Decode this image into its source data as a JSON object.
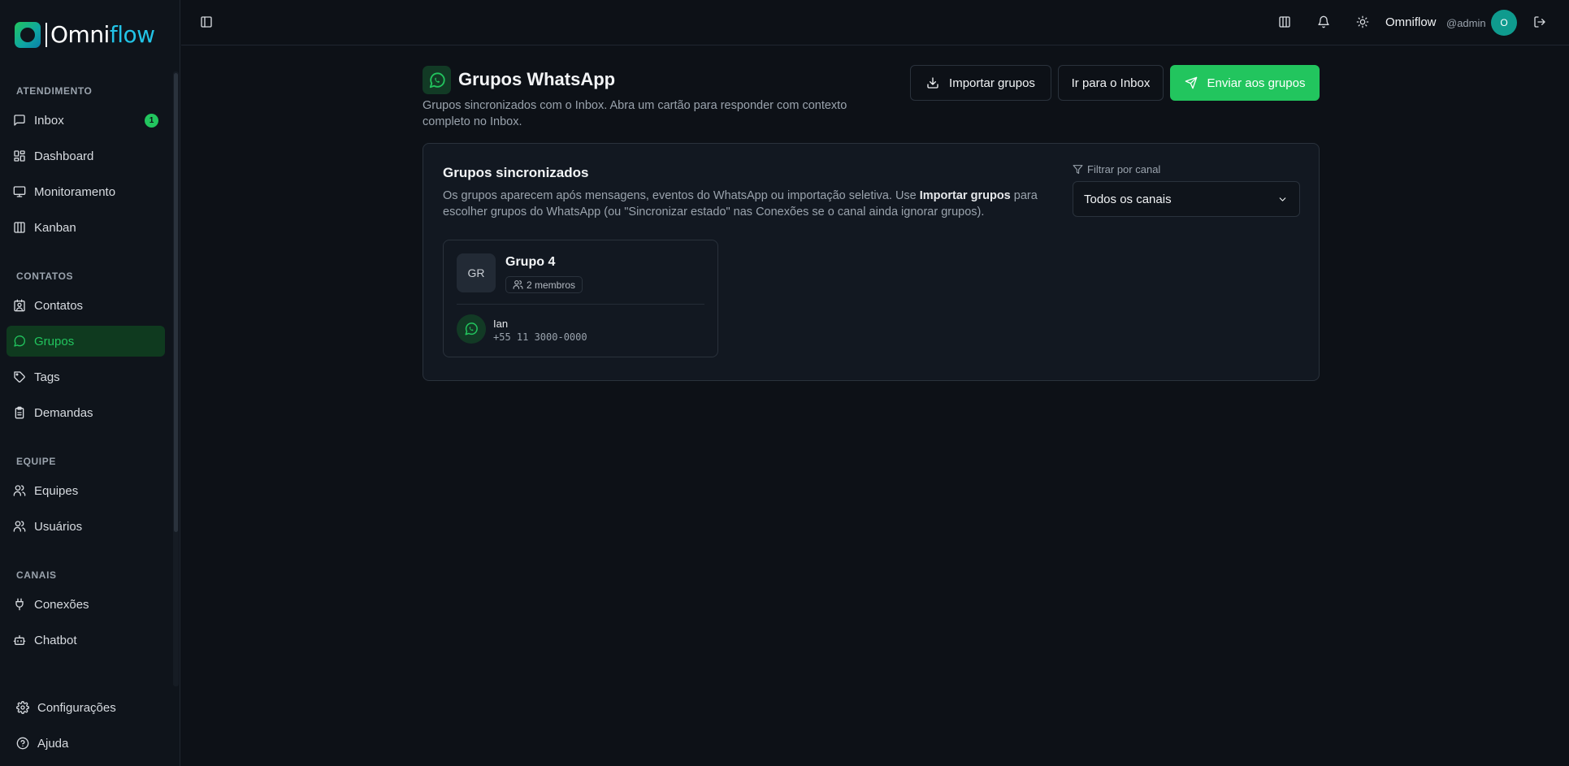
{
  "brand": {
    "logo_prefix": "Omni",
    "logo_suffix": "flow"
  },
  "sidebar": {
    "sections": [
      {
        "title": "ATENDIMENTO"
      },
      {
        "title": "CONTATOS"
      },
      {
        "title": "EQUIPE"
      },
      {
        "title": "CANAIS"
      }
    ],
    "items": [
      {
        "label": "Inbox",
        "icon": "message-square-icon",
        "badge": "1"
      },
      {
        "label": "Dashboard",
        "icon": "layout-dashboard-icon"
      },
      {
        "label": "Monitoramento",
        "icon": "monitor-icon"
      },
      {
        "label": "Kanban",
        "icon": "columns-icon"
      },
      {
        "label": "Contatos",
        "icon": "contact-icon"
      },
      {
        "label": "Grupos",
        "icon": "whatsapp-icon",
        "active": true
      },
      {
        "label": "Tags",
        "icon": "tag-icon"
      },
      {
        "label": "Demandas",
        "icon": "clipboard-icon"
      },
      {
        "label": "Equipes",
        "icon": "users-icon"
      },
      {
        "label": "Usuários",
        "icon": "user-group-icon"
      },
      {
        "label": "Conexões",
        "icon": "plug-icon"
      },
      {
        "label": "Chatbot",
        "icon": "bot-icon"
      }
    ],
    "footer": [
      {
        "label": "Configurações",
        "icon": "gear-icon"
      },
      {
        "label": "Ajuda",
        "icon": "help-circle-icon"
      }
    ]
  },
  "topbar": {
    "user_name": "Omniflow",
    "user_handle": "@admin",
    "avatar_initial": "O"
  },
  "page": {
    "title": "Grupos WhatsApp",
    "subtitle": "Grupos sincronizados com o Inbox. Abra um cartão para responder com contexto completo no Inbox.",
    "buttons": {
      "import": "Importar grupos",
      "inbox": "Ir para o Inbox",
      "send": "Enviar aos grupos"
    }
  },
  "synced": {
    "title": "Grupos sincronizados",
    "desc_before": "Os grupos aparecem após mensagens, eventos do WhatsApp ou importação seletiva. Use ",
    "desc_bold": "Importar grupos",
    "desc_after": " para escolher grupos do WhatsApp (ou \"Sincronizar estado\" nas Conexões se o canal ainda ignorar grupos).",
    "filter_label": "Filtrar por canal",
    "filter_value": "Todos os canais",
    "groups": [
      {
        "initials": "GR",
        "name": "Grupo 4",
        "members_label": "2 membros",
        "member_name": "Ian",
        "member_phone": "+55 11 3000-0000"
      }
    ]
  },
  "colors": {
    "accent": "#22c55e",
    "background": "#0d1117",
    "card": "#121821"
  }
}
